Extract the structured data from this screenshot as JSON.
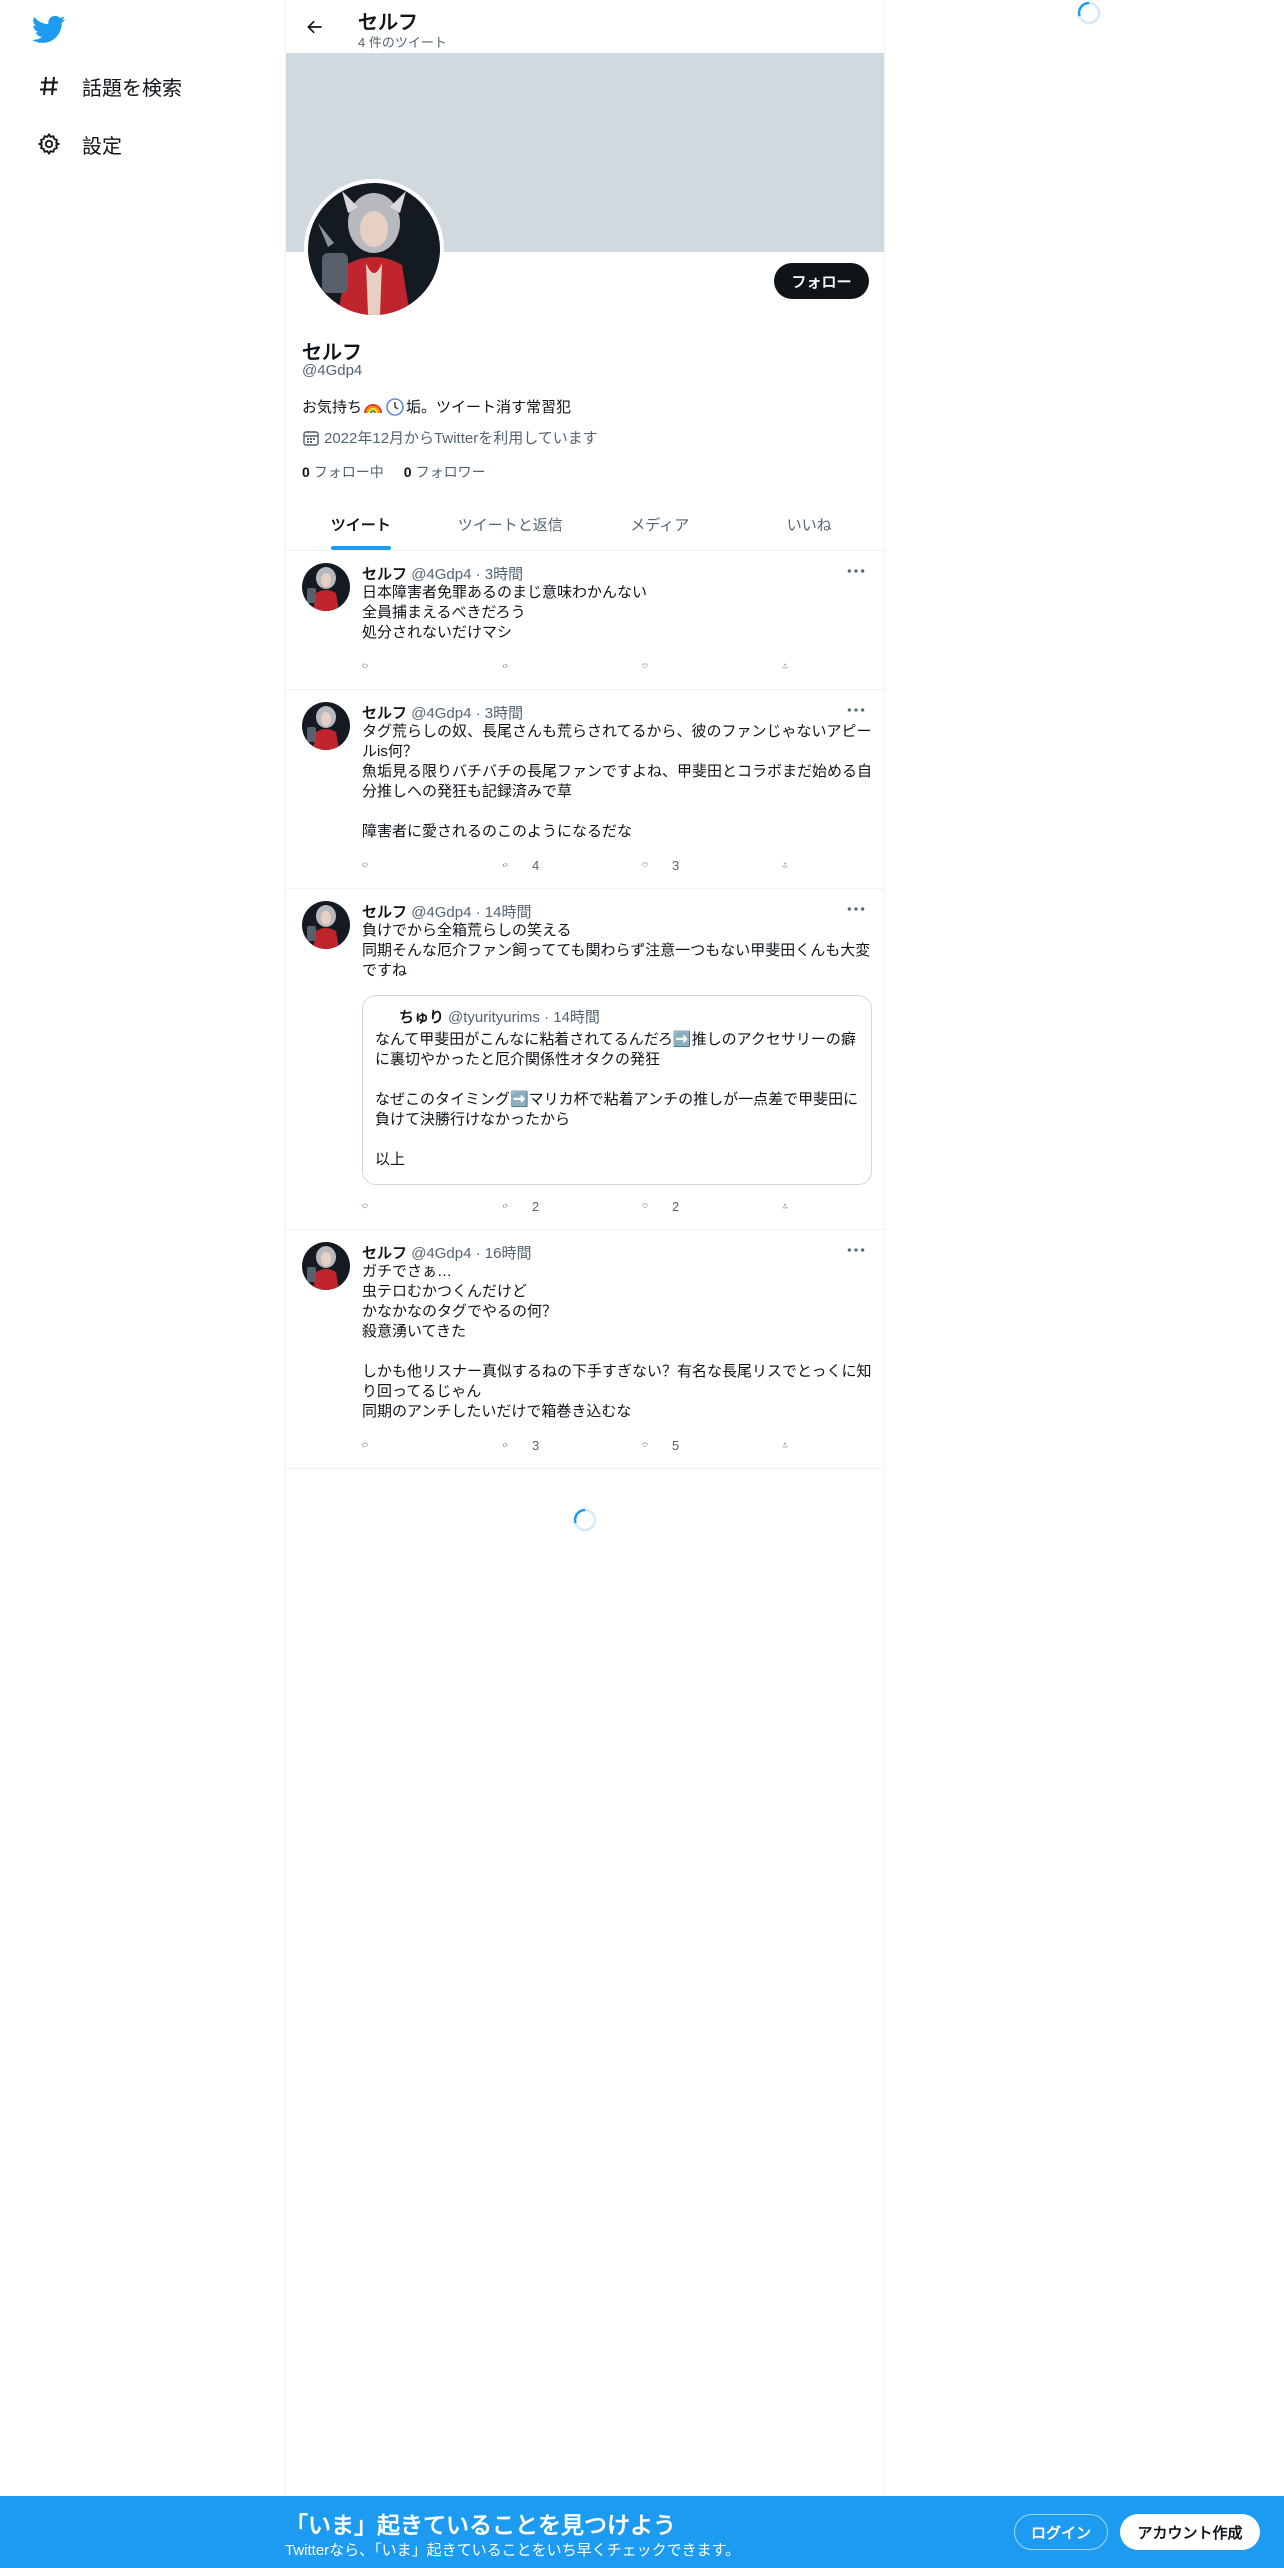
{
  "nav": {
    "logo": "twitter-bird-icon",
    "explore_label": "話題を検索",
    "settings_label": "設定"
  },
  "header": {
    "title": "セルフ",
    "tweet_count": "4 件のツイート"
  },
  "profile": {
    "name": "セルフ",
    "handle": "@4Gdp4",
    "bio_parts": [
      "お気持ち",
      "垢。ツイート消す常習犯"
    ],
    "bio_emojis": [
      "rainbow",
      "clock"
    ],
    "joined": "2022年12月からTwitterを利用しています",
    "following_count": "0",
    "following_label": "フォロー中",
    "followers_count": "0",
    "followers_label": "フォロワー",
    "follow_button": "フォロー"
  },
  "tabs": [
    "ツイート",
    "ツイートと返信",
    "メディア",
    "いいね"
  ],
  "tweets": [
    {
      "name": "セルフ",
      "handle": "@4Gdp4 · 3時間",
      "text": "日本障害者免罪あるのまじ意味わかんない\n全員捕まえるべきだろう\n処分されないだけマシ",
      "retweets": "",
      "likes": ""
    },
    {
      "name": "セルフ",
      "handle": "@4Gdp4 · 3時間",
      "text": "タグ荒らしの奴、長尾さんも荒らされてるから、彼のファンじゃないアピールis何？\n魚垢見る限りバチバチの長尾ファンですよね、甲斐田とコラボまだ始める自分推しへの発狂も記録済みで草\n\n障害者に愛されるのこのようになるだな",
      "retweets": "4",
      "likes": "3"
    },
    {
      "name": "セルフ",
      "handle": "@4Gdp4 · 14時間",
      "text": "負けでから全箱荒らしの笑える\n同期そんな厄介ファン飼ってても関わらず注意一つもない甲斐田くんも大変ですね",
      "retweets": "2",
      "likes": "2",
      "quote": {
        "name": "ちゅり",
        "handle": "@tyurityurims · 14時間",
        "text": "なんて甲斐田がこんなに粘着されてるんだろ➡️推しのアクセサリーの癖に裏切やかったと厄介関係性オタクの発狂\n\nなぜこのタイミング➡️マリカ杯で粘着アンチの推しが一点差で甲斐田に負けて決勝行けなかったから\n\n以上"
      }
    },
    {
      "name": "セルフ",
      "handle": "@4Gdp4 · 16時間",
      "text": "ガチでさぁ…\n虫テロむかつくんだけど\nかなかなのタグでやるの何？\n殺意湧いてきた\n\nしかも他リスナー真似するねの下手すぎない？有名な長尾リスでとっくに知り回ってるじゃん\n同期のアンチしたいだけで箱巻き込むな",
      "retweets": "3",
      "likes": "5"
    }
  ],
  "bottom": {
    "title": "「いま」起きていることを見つけよう",
    "subtitle": "Twitterなら、「いま」起きていることをいち早くチェックできます。",
    "login": "ログイン",
    "signup": "アカウント作成"
  },
  "colors": {
    "accent": "#1d9bf0",
    "banner": "#cfd9de",
    "text": "#0f1419",
    "muted": "#536471"
  }
}
